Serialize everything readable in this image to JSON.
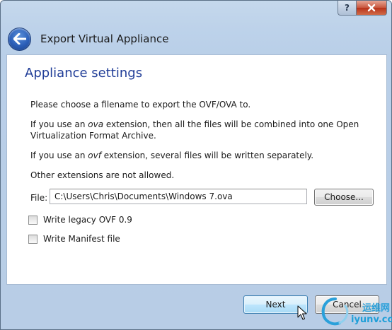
{
  "window": {
    "help_symbol": "?",
    "header_title": "Export Virtual Appliance"
  },
  "page": {
    "title": "Appliance settings",
    "para1": "Please choose a filename to export the OVF/OVA to.",
    "para2_a": "If you use an ",
    "para2_em": "ova",
    "para2_b": " extension, then all the files will be combined into one Open Virtualization Format Archive.",
    "para3_a": "If you use an ",
    "para3_em": "ovf",
    "para3_b": " extension, several files will be written separately.",
    "para4": "Other extensions are not allowed."
  },
  "file": {
    "label": "File:",
    "value": "C:\\Users\\Chris\\Documents\\Windows 7.ova",
    "choose_label": "Choose..."
  },
  "options": [
    {
      "label": "Write legacy OVF 0.9",
      "checked": false
    },
    {
      "label": "Write Manifest file",
      "checked": false
    }
  ],
  "footer": {
    "next_label": "Next",
    "cancel_label": "Cancel"
  },
  "watermark": {
    "text": "iyunv.com",
    "cn": "运维网"
  },
  "icons": {
    "back": "back-arrow-icon",
    "help": "help-icon",
    "close": "close-icon",
    "cursor": "mouse-pointer-icon"
  }
}
